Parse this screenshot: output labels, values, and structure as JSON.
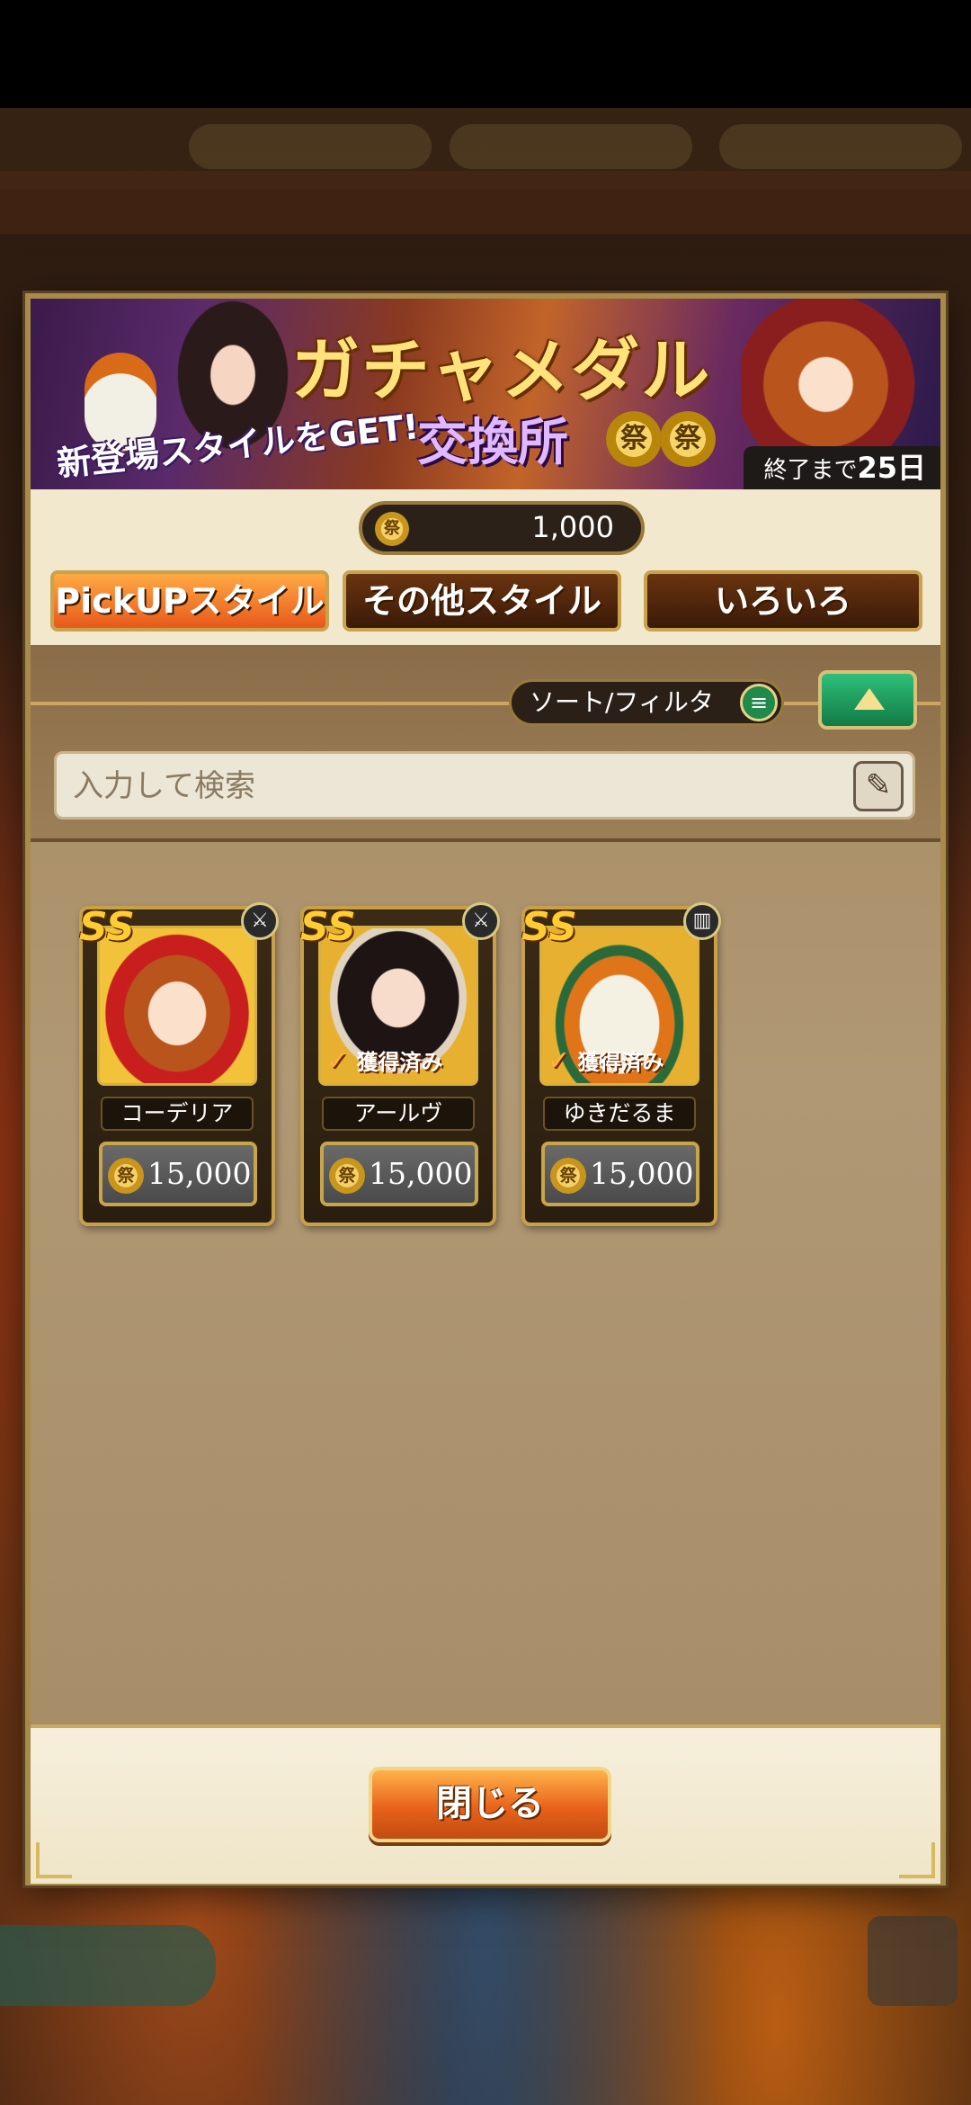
{
  "banner": {
    "title": "ガチャメダル",
    "subtitle": "交換所",
    "tagline": "新登場スタイルをGET!",
    "coin_glyph": "祭",
    "deadline_prefix": "終了まで",
    "deadline_value": "25日"
  },
  "currency": {
    "coin_glyph": "祭",
    "amount": "1,000"
  },
  "tabs": [
    {
      "label": "PickUPスタイル",
      "active": true
    },
    {
      "label": "その他スタイル",
      "active": false
    },
    {
      "label": "いろいろ",
      "active": false
    }
  ],
  "toolbar": {
    "sort_label": "ソート/フィルタ",
    "search_placeholder": "入力して検索"
  },
  "cards": [
    {
      "name": "コーデリア",
      "price": "15,000",
      "rank": "SS",
      "obtained": false,
      "obtained_label": "",
      "type_icon": "sword-icon"
    },
    {
      "name": "アールヴ",
      "price": "15,000",
      "rank": "SS",
      "obtained": true,
      "obtained_label": "獲得済み",
      "type_icon": "sword-icon"
    },
    {
      "name": "ゆきだるま",
      "price": "15,000",
      "rank": "SS",
      "obtained": true,
      "obtained_label": "獲得済み",
      "type_icon": "gauntlet-icon"
    }
  ],
  "footer": {
    "close_label": "閉じる"
  },
  "colors": {
    "accent_orange": "#e8581a",
    "frame_gold": "#c8a04a",
    "collapse_green": "#1f9a5a"
  }
}
